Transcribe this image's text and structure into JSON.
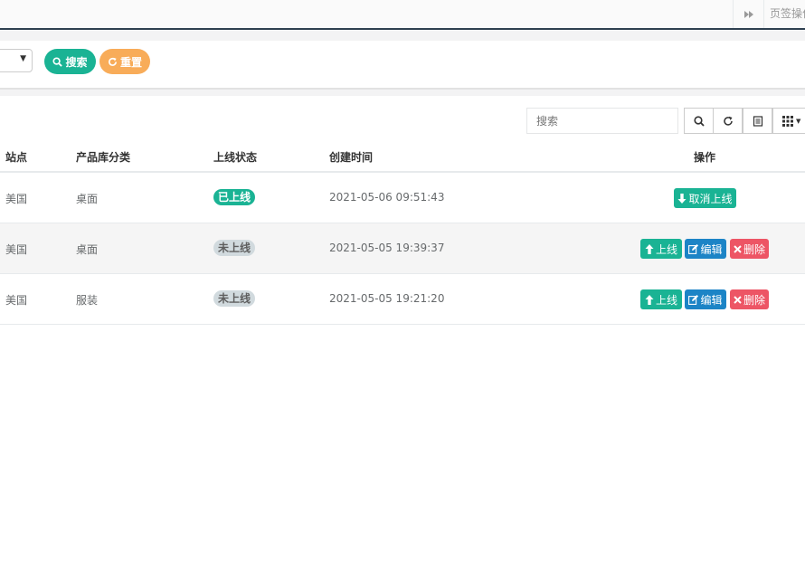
{
  "topbar": {
    "tab_ops_label": "页签操作"
  },
  "search_panel": {
    "search_label": "搜索",
    "reset_label": "重置"
  },
  "toolbar": {
    "search_placeholder": "搜索"
  },
  "table": {
    "headers": {
      "site": "站点",
      "category": "产品库分类",
      "status": "上线状态",
      "created": "创建时间",
      "actions": "操作"
    },
    "rows": [
      {
        "site": "美国",
        "category": "桌面",
        "status": "已上线",
        "created": "2021-05-06 09:51:43",
        "action_offline": "取消上线"
      },
      {
        "site": "美国",
        "category": "桌面",
        "status": "未上线",
        "created": "2021-05-05 19:39:37",
        "action_online": "上线",
        "action_edit": "编辑",
        "action_delete": "删除"
      },
      {
        "site": "美国",
        "category": "服装",
        "status": "未上线",
        "created": "2021-05-05 19:21:20",
        "action_online": "上线",
        "action_edit": "编辑",
        "action_delete": "删除"
      }
    ]
  },
  "colors": {
    "primary": "#1ab394",
    "warning": "#f8ac59",
    "info": "#1c84c6",
    "danger": "#ed5565",
    "muted_badge": "#d1dade"
  }
}
